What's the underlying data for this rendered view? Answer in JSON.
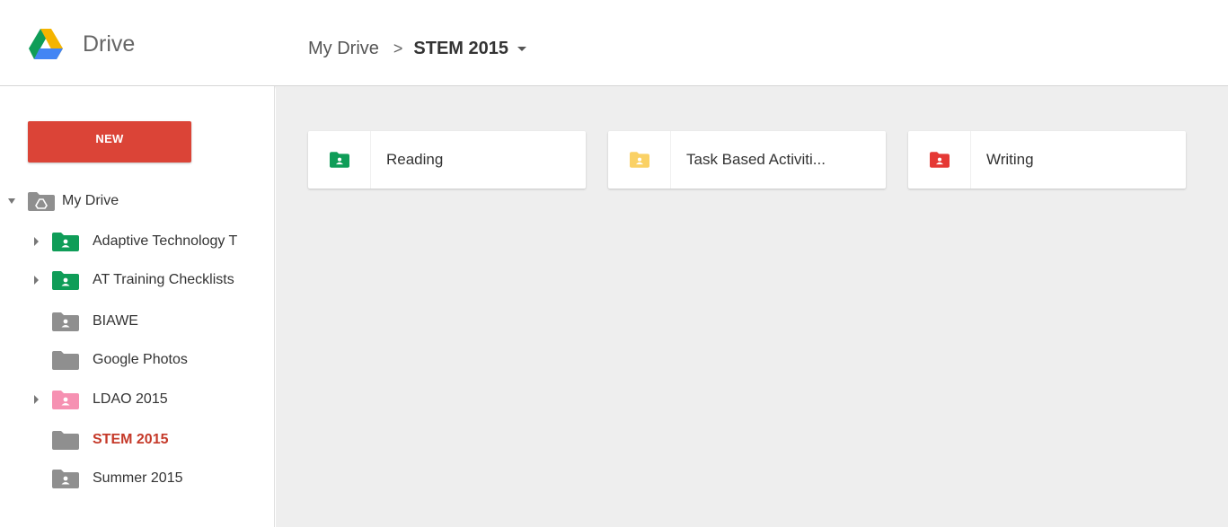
{
  "app": {
    "name": "Drive"
  },
  "breadcrumb": {
    "parent": "My Drive",
    "separator": ">",
    "current": "STEM 2015"
  },
  "sidebar": {
    "new_label": "NEW",
    "root": {
      "label": "My Drive",
      "expanded": true
    },
    "items": [
      {
        "label": "Adaptive Technology T",
        "color": "#0f9d58",
        "shared": true,
        "expandable": true,
        "active": false
      },
      {
        "label": "AT Training Checklists",
        "color": "#0f9d58",
        "shared": true,
        "expandable": true,
        "active": false
      },
      {
        "label": "BIAWE",
        "color": "#8f8f8f",
        "shared": true,
        "expandable": false,
        "active": false
      },
      {
        "label": "Google Photos",
        "color": "#8f8f8f",
        "shared": false,
        "expandable": false,
        "active": false
      },
      {
        "label": "LDAO 2015",
        "color": "#f691b2",
        "shared": true,
        "expandable": true,
        "active": false
      },
      {
        "label": "STEM 2015",
        "color": "#8f8f8f",
        "shared": false,
        "expandable": false,
        "active": true
      },
      {
        "label": "Summer 2015",
        "color": "#8f8f8f",
        "shared": true,
        "expandable": false,
        "active": false
      }
    ]
  },
  "folders": [
    {
      "name": "Reading",
      "color": "#0f9d58"
    },
    {
      "name": "Task Based Activiti...",
      "color": "#fad165"
    },
    {
      "name": "Writing",
      "color": "#e53935"
    }
  ],
  "colors": {
    "new_button": "#db4437",
    "active_text": "#c53929",
    "content_bg": "#eeeeee"
  }
}
